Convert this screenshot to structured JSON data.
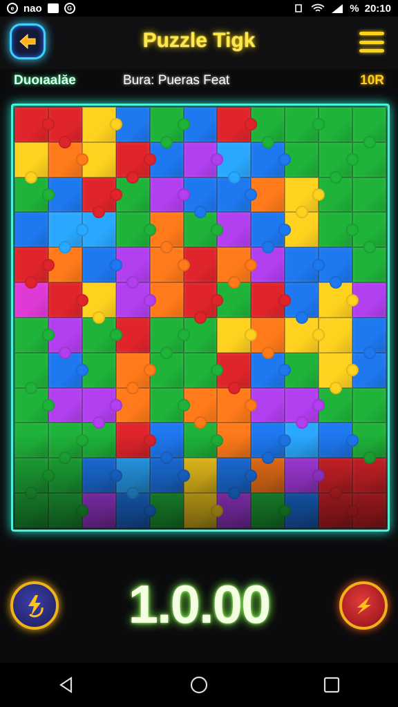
{
  "status_bar": {
    "left_text": "nao",
    "time": "20:10",
    "battery_text": "%"
  },
  "header": {
    "title": "Puzzle Tigk"
  },
  "info": {
    "left": "Duoıaalăe",
    "middle": "Bura: Pueras Feat",
    "right": "10R"
  },
  "board": {
    "columns": 11,
    "rows": 12,
    "palette": {
      "R": "#e0242b",
      "O": "#ff7a1a",
      "Y": "#ffd21f",
      "G": "#1fb33a",
      "B": "#1e78f0",
      "C": "#2aa8ff",
      "P": "#b23ff0",
      "M": "#e03ad6"
    },
    "layout": [
      "RRYBGBRGGGG",
      "YOYRBPCBGGG",
      "GBRGPBBOYGG",
      "BCCGOGPBYGG",
      "ROBPOROPBBG",
      "MRYPORGRBYP",
      "GPGRGGYOYYB",
      "GBGOGGRBGYB",
      "GPPOGOOPPGG",
      "GGGRBGOBCBG",
      "GGBCBYBOPRR",
      "GGPBGYPGBRR"
    ]
  },
  "footer": {
    "score": "1.0.00"
  },
  "colors": {
    "accent_cyan": "#4df1d8",
    "title_yellow": "#ffe94a",
    "score_glow": "#7dff4a"
  },
  "icons": {
    "back": "arrow-left-icon",
    "menu": "hamburger-menu-icon",
    "hint": "lightning-swap-icon",
    "boost": "lightning-icon"
  }
}
